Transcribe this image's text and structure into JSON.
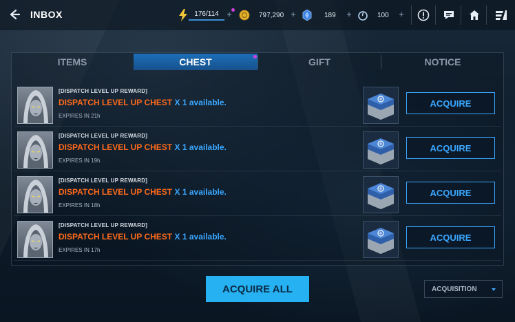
{
  "header": {
    "title": "INBOX",
    "energy": "176/114",
    "gold": "797,290",
    "crystal": "189",
    "orb": "100"
  },
  "tabs": [
    {
      "label": "ITEMS",
      "active": false
    },
    {
      "label": "CHEST",
      "active": true
    },
    {
      "label": "GIFT",
      "active": false
    },
    {
      "label": "NOTICE",
      "active": false
    }
  ],
  "rows": [
    {
      "title": "[DISPATCH LEVEL UP REWARD]",
      "name": "DISPATCH LEVEL UP CHEST",
      "count": "X 1",
      "avail": "available.",
      "expires": "EXPIRES IN 21h",
      "button": "ACQUIRE"
    },
    {
      "title": "[DISPATCH LEVEL UP REWARD]",
      "name": "DISPATCH LEVEL UP CHEST",
      "count": "X 1",
      "avail": "available.",
      "expires": "EXPIRES IN 19h",
      "button": "ACQUIRE"
    },
    {
      "title": "[DISPATCH LEVEL UP REWARD]",
      "name": "DISPATCH LEVEL UP CHEST",
      "count": "X 1",
      "avail": "available.",
      "expires": "EXPIRES IN 18h",
      "button": "ACQUIRE"
    },
    {
      "title": "[DISPATCH LEVEL UP REWARD]",
      "name": "DISPATCH LEVEL UP CHEST",
      "count": "X 1",
      "avail": "available.",
      "expires": "EXPIRES IN 17h",
      "button": "ACQUIRE"
    }
  ],
  "footer": {
    "acquire_all": "ACQUIRE ALL",
    "sort": "ACQUISITION"
  },
  "colors": {
    "accent": "#3ba7ff",
    "item_name": "#ff6a1a",
    "primary_button": "#25b1f2",
    "tab_active": "#1c6eb8",
    "notification": "#d040e0"
  },
  "icons": {
    "back": "back-arrow-icon",
    "energy": "lightning-icon",
    "gold": "gold-coin-icon",
    "crystal": "blue-crystal-icon",
    "orb": "orb-icon",
    "alert": "alert-icon",
    "chat": "chat-icon",
    "home": "home-icon",
    "menu": "menu-icon",
    "chest": "chest-icon",
    "dropdown": "dropdown-caret-icon"
  }
}
